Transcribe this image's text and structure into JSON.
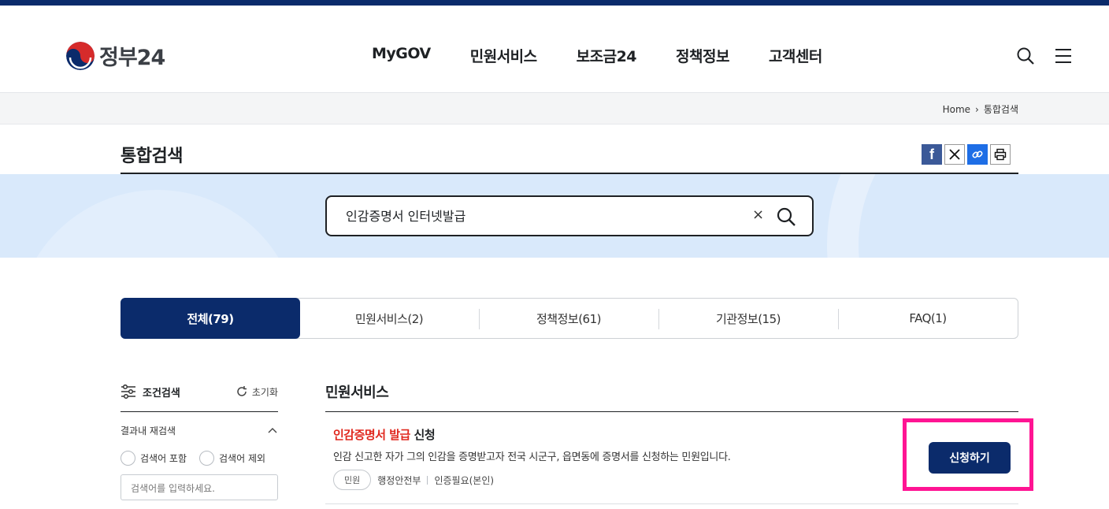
{
  "header": {
    "logo_text": "정부24",
    "nav": [
      "MyGOV",
      "민원서비스",
      "보조금24",
      "정책정보",
      "고객센터"
    ]
  },
  "breadcrumb": {
    "home": "Home",
    "current": "통합검색"
  },
  "page_title": "통합검색",
  "search": {
    "value": "인감증명서 인터넷발급",
    "clear": "×"
  },
  "tabs": [
    {
      "label": "전체(79)",
      "active": true
    },
    {
      "label": "민원서비스(2)"
    },
    {
      "label": "정책정보(61)"
    },
    {
      "label": "기관정보(15)"
    },
    {
      "label": "FAQ(1)"
    }
  ],
  "filter": {
    "title": "조건검색",
    "reset": "초기화",
    "section": "결과내 재검색",
    "include": "검색어 포함",
    "exclude": "검색어 제외",
    "placeholder": "검색어를 입력하세요."
  },
  "results": {
    "section_title": "민원서비스",
    "item": {
      "title_highlight": "인감증명서 발급",
      "title_rest": " 신청",
      "desc": "인감 신고한 자가 그의 인감을 증명받고자 전국 시군구, 읍면동에 증명서를 신청하는 민원입니다.",
      "badge": "민원",
      "agency": "행정안전부",
      "auth": "인증필요(본인)",
      "button": "신청하기"
    }
  },
  "colors": {
    "primary": "#0b2b6b",
    "highlight": "#e0281e",
    "annotation": "#ff1493",
    "band": "#d9e9fb"
  }
}
